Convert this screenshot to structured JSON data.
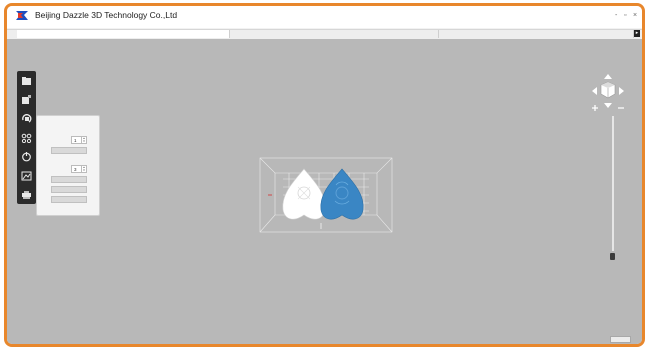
{
  "window": {
    "title": "Beijing Dazzle 3D Technology Co.,Ltd",
    "controls": {
      "minimize": "-",
      "maximize": "▫",
      "close": "×"
    }
  },
  "menu": [
    "",
    "",
    "",
    ""
  ],
  "tabs": [
    {
      "label": "",
      "active": true
    },
    {
      "label": "",
      "active": false
    },
    {
      "label": "",
      "active": false
    }
  ],
  "toolbar": {
    "buttons": [
      {
        "name": "open-file-icon"
      },
      {
        "name": "add-model-icon"
      },
      {
        "name": "rotate-model-icon"
      },
      {
        "name": "layout-models-icon"
      },
      {
        "name": "support-icon"
      },
      {
        "name": "slice-preview-icon"
      },
      {
        "name": "print-icon"
      }
    ]
  },
  "panel": {
    "title": "",
    "copy_section": "",
    "count_label": "",
    "count_value": "1",
    "copy_button": "",
    "arrange_section": "",
    "spacing_label": "",
    "spacing_value": "3",
    "select_all_button": "",
    "invert_button": "",
    "auto_arrange_button": ""
  },
  "viewport": {
    "corner_button": ""
  },
  "colors": {
    "frame_border": "#e8872c",
    "viewport_bg": "#b8b8b8",
    "toolbar_bg": "#2b2b2b",
    "selected_model": "#3a86c4",
    "unselected_model": "#ffffff"
  }
}
